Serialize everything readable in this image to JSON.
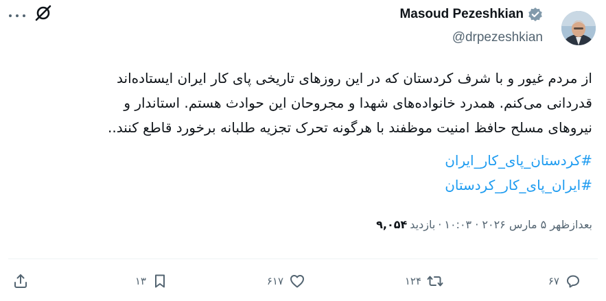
{
  "author": {
    "name": "Masoud Pezeshkian",
    "handle": "@drpezeshkian",
    "verified_color": "#829aab"
  },
  "tweet": {
    "lines": [
      "از مردم غیور و با شرف کردستان که در این روزهای تاریخی پای کار ایران ایستاده‌اند",
      "قدردانی می‌کنم. همدرد خانواده‌های شهدا و مجروحان این حوادث هستم. استاندار و",
      "نیروهای مسلح حافظ امنیت موظفند با هرگونه تحرک تجزیه طلبانه برخورد قاطع کنند.."
    ],
    "hashtags": [
      "#کردستان_پای_کار_ایران",
      "#ایران_پای_کار_کردستان"
    ]
  },
  "meta": {
    "time": "بعدازظهر ۵ مارس ۲۰۲۶ · ۱۰:۰۳",
    "views_label": "بازدید",
    "views": "۹,۰۵۴"
  },
  "actions": {
    "replies": "۶۷",
    "retweets": "۱۲۴",
    "likes": "۶۱۷",
    "bookmarks": "۱۳"
  },
  "icons": {
    "more": "more-icon",
    "grok": "grok-icon",
    "reply": "reply-icon",
    "retweet": "retweet-icon",
    "like": "heart-icon",
    "bookmark": "bookmark-icon",
    "share": "share-icon"
  },
  "colors": {
    "link": "#1d9bf0",
    "secondary_text": "#536471",
    "primary_text": "#0f1419"
  }
}
